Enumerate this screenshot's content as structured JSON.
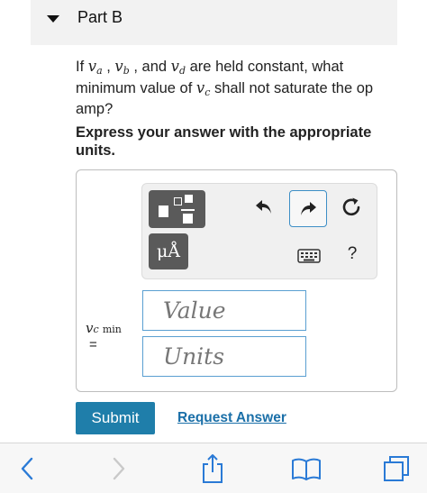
{
  "part": {
    "title": "Part B"
  },
  "question": {
    "lead": "If ",
    "va": "v",
    "va_sub": "a",
    "sep1": " , ",
    "vb": "v",
    "vb_sub": "b",
    "sep2": " , and ",
    "vd": "v",
    "vd_sub": "d",
    "mid": " are held constant, what minimum value of ",
    "vc": "v",
    "vc_sub": "c",
    "tail": " shall not saturate the op amp?"
  },
  "instruction": "Express your answer with the appropriate units.",
  "toolbar": {
    "units_label": "μÅ",
    "help_label": "?"
  },
  "answer": {
    "var_symbol": "v",
    "var_sub": "c",
    "var_suffix": "min",
    "equals": "=",
    "value_placeholder": "Value",
    "units_placeholder": "Units"
  },
  "actions": {
    "submit_label": "Submit",
    "request_label": "Request Answer"
  },
  "colors": {
    "accent": "#1f7eaa",
    "link": "#1a6fa8",
    "field_border": "#5a9fd1"
  }
}
